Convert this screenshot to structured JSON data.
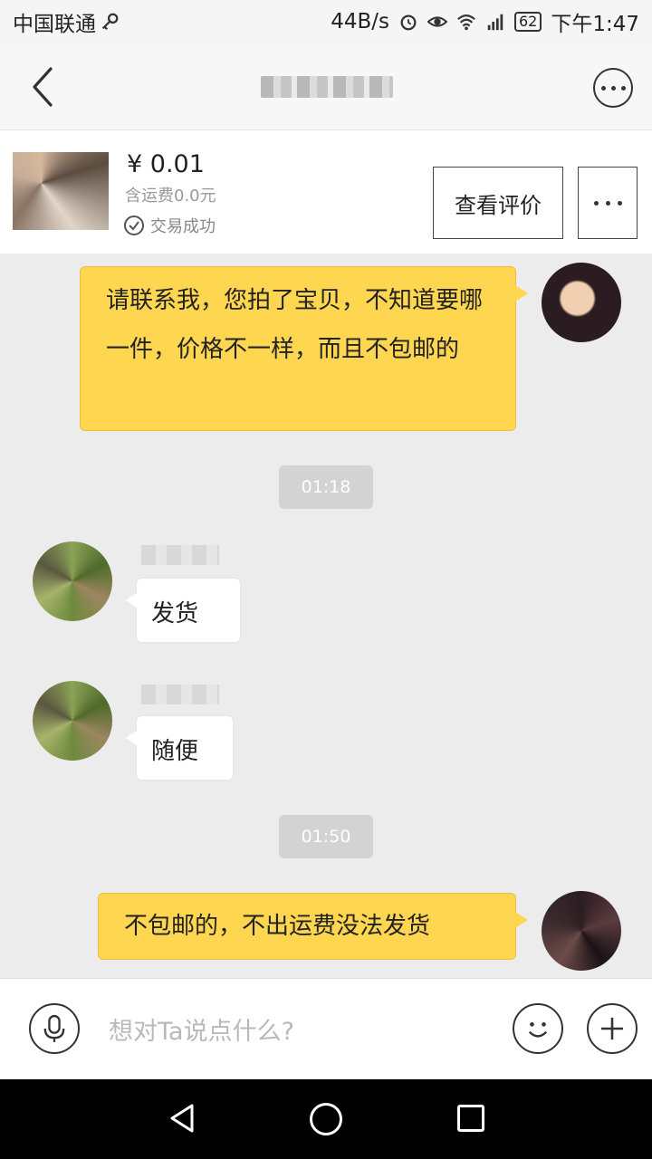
{
  "status_bar": {
    "carrier": "中国联通",
    "speed": "44B/s",
    "battery": "62",
    "time": "下午1:47"
  },
  "product": {
    "price": "¥ 0.01",
    "shipping": "含运费0.0元",
    "deal_status": "交易成功",
    "review_label": "查看评价"
  },
  "chat": {
    "messages": [
      {
        "from": "self",
        "text": "请联系我，您拍了宝贝，不知道要哪一件，价格不一样，而且不包邮的"
      },
      {
        "time": "01:18"
      },
      {
        "from": "other",
        "text": "发货"
      },
      {
        "from": "other",
        "text": "随便"
      },
      {
        "time": "01:50"
      },
      {
        "from": "self",
        "text": "不包邮的，不出运费没法发货"
      }
    ]
  },
  "input": {
    "placeholder": "想对Ta说点什么?"
  }
}
